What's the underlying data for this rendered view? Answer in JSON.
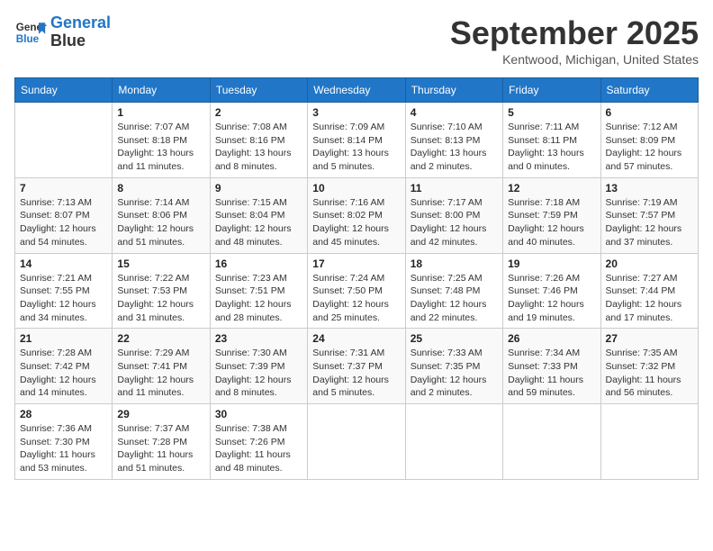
{
  "logo": {
    "line1": "General",
    "line2": "Blue"
  },
  "title": "September 2025",
  "location": "Kentwood, Michigan, United States",
  "days_header": [
    "Sunday",
    "Monday",
    "Tuesday",
    "Wednesday",
    "Thursday",
    "Friday",
    "Saturday"
  ],
  "weeks": [
    [
      {
        "day": "",
        "sunrise": "",
        "sunset": "",
        "daylight": ""
      },
      {
        "day": "1",
        "sunrise": "Sunrise: 7:07 AM",
        "sunset": "Sunset: 8:18 PM",
        "daylight": "Daylight: 13 hours and 11 minutes."
      },
      {
        "day": "2",
        "sunrise": "Sunrise: 7:08 AM",
        "sunset": "Sunset: 8:16 PM",
        "daylight": "Daylight: 13 hours and 8 minutes."
      },
      {
        "day": "3",
        "sunrise": "Sunrise: 7:09 AM",
        "sunset": "Sunset: 8:14 PM",
        "daylight": "Daylight: 13 hours and 5 minutes."
      },
      {
        "day": "4",
        "sunrise": "Sunrise: 7:10 AM",
        "sunset": "Sunset: 8:13 PM",
        "daylight": "Daylight: 13 hours and 2 minutes."
      },
      {
        "day": "5",
        "sunrise": "Sunrise: 7:11 AM",
        "sunset": "Sunset: 8:11 PM",
        "daylight": "Daylight: 13 hours and 0 minutes."
      },
      {
        "day": "6",
        "sunrise": "Sunrise: 7:12 AM",
        "sunset": "Sunset: 8:09 PM",
        "daylight": "Daylight: 12 hours and 57 minutes."
      }
    ],
    [
      {
        "day": "7",
        "sunrise": "Sunrise: 7:13 AM",
        "sunset": "Sunset: 8:07 PM",
        "daylight": "Daylight: 12 hours and 54 minutes."
      },
      {
        "day": "8",
        "sunrise": "Sunrise: 7:14 AM",
        "sunset": "Sunset: 8:06 PM",
        "daylight": "Daylight: 12 hours and 51 minutes."
      },
      {
        "day": "9",
        "sunrise": "Sunrise: 7:15 AM",
        "sunset": "Sunset: 8:04 PM",
        "daylight": "Daylight: 12 hours and 48 minutes."
      },
      {
        "day": "10",
        "sunrise": "Sunrise: 7:16 AM",
        "sunset": "Sunset: 8:02 PM",
        "daylight": "Daylight: 12 hours and 45 minutes."
      },
      {
        "day": "11",
        "sunrise": "Sunrise: 7:17 AM",
        "sunset": "Sunset: 8:00 PM",
        "daylight": "Daylight: 12 hours and 42 minutes."
      },
      {
        "day": "12",
        "sunrise": "Sunrise: 7:18 AM",
        "sunset": "Sunset: 7:59 PM",
        "daylight": "Daylight: 12 hours and 40 minutes."
      },
      {
        "day": "13",
        "sunrise": "Sunrise: 7:19 AM",
        "sunset": "Sunset: 7:57 PM",
        "daylight": "Daylight: 12 hours and 37 minutes."
      }
    ],
    [
      {
        "day": "14",
        "sunrise": "Sunrise: 7:21 AM",
        "sunset": "Sunset: 7:55 PM",
        "daylight": "Daylight: 12 hours and 34 minutes."
      },
      {
        "day": "15",
        "sunrise": "Sunrise: 7:22 AM",
        "sunset": "Sunset: 7:53 PM",
        "daylight": "Daylight: 12 hours and 31 minutes."
      },
      {
        "day": "16",
        "sunrise": "Sunrise: 7:23 AM",
        "sunset": "Sunset: 7:51 PM",
        "daylight": "Daylight: 12 hours and 28 minutes."
      },
      {
        "day": "17",
        "sunrise": "Sunrise: 7:24 AM",
        "sunset": "Sunset: 7:50 PM",
        "daylight": "Daylight: 12 hours and 25 minutes."
      },
      {
        "day": "18",
        "sunrise": "Sunrise: 7:25 AM",
        "sunset": "Sunset: 7:48 PM",
        "daylight": "Daylight: 12 hours and 22 minutes."
      },
      {
        "day": "19",
        "sunrise": "Sunrise: 7:26 AM",
        "sunset": "Sunset: 7:46 PM",
        "daylight": "Daylight: 12 hours and 19 minutes."
      },
      {
        "day": "20",
        "sunrise": "Sunrise: 7:27 AM",
        "sunset": "Sunset: 7:44 PM",
        "daylight": "Daylight: 12 hours and 17 minutes."
      }
    ],
    [
      {
        "day": "21",
        "sunrise": "Sunrise: 7:28 AM",
        "sunset": "Sunset: 7:42 PM",
        "daylight": "Daylight: 12 hours and 14 minutes."
      },
      {
        "day": "22",
        "sunrise": "Sunrise: 7:29 AM",
        "sunset": "Sunset: 7:41 PM",
        "daylight": "Daylight: 12 hours and 11 minutes."
      },
      {
        "day": "23",
        "sunrise": "Sunrise: 7:30 AM",
        "sunset": "Sunset: 7:39 PM",
        "daylight": "Daylight: 12 hours and 8 minutes."
      },
      {
        "day": "24",
        "sunrise": "Sunrise: 7:31 AM",
        "sunset": "Sunset: 7:37 PM",
        "daylight": "Daylight: 12 hours and 5 minutes."
      },
      {
        "day": "25",
        "sunrise": "Sunrise: 7:33 AM",
        "sunset": "Sunset: 7:35 PM",
        "daylight": "Daylight: 12 hours and 2 minutes."
      },
      {
        "day": "26",
        "sunrise": "Sunrise: 7:34 AM",
        "sunset": "Sunset: 7:33 PM",
        "daylight": "Daylight: 11 hours and 59 minutes."
      },
      {
        "day": "27",
        "sunrise": "Sunrise: 7:35 AM",
        "sunset": "Sunset: 7:32 PM",
        "daylight": "Daylight: 11 hours and 56 minutes."
      }
    ],
    [
      {
        "day": "28",
        "sunrise": "Sunrise: 7:36 AM",
        "sunset": "Sunset: 7:30 PM",
        "daylight": "Daylight: 11 hours and 53 minutes."
      },
      {
        "day": "29",
        "sunrise": "Sunrise: 7:37 AM",
        "sunset": "Sunset: 7:28 PM",
        "daylight": "Daylight: 11 hours and 51 minutes."
      },
      {
        "day": "30",
        "sunrise": "Sunrise: 7:38 AM",
        "sunset": "Sunset: 7:26 PM",
        "daylight": "Daylight: 11 hours and 48 minutes."
      },
      {
        "day": "",
        "sunrise": "",
        "sunset": "",
        "daylight": ""
      },
      {
        "day": "",
        "sunrise": "",
        "sunset": "",
        "daylight": ""
      },
      {
        "day": "",
        "sunrise": "",
        "sunset": "",
        "daylight": ""
      },
      {
        "day": "",
        "sunrise": "",
        "sunset": "",
        "daylight": ""
      }
    ]
  ]
}
